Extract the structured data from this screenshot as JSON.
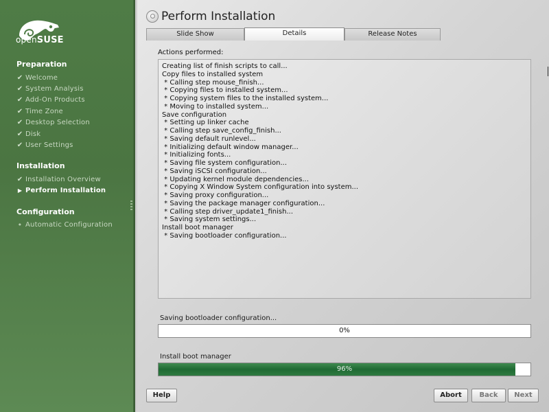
{
  "logo": {
    "prefix": "open",
    "brand": "SUSE"
  },
  "sidebar": {
    "sections": [
      {
        "label": "Preparation",
        "items": [
          {
            "label": "Welcome",
            "state": "done"
          },
          {
            "label": "System Analysis",
            "state": "done"
          },
          {
            "label": "Add-On Products",
            "state": "done"
          },
          {
            "label": "Time Zone",
            "state": "done"
          },
          {
            "label": "Desktop Selection",
            "state": "done"
          },
          {
            "label": "Disk",
            "state": "done"
          },
          {
            "label": "User Settings",
            "state": "done"
          }
        ]
      },
      {
        "label": "Installation",
        "items": [
          {
            "label": "Installation Overview",
            "state": "done"
          },
          {
            "label": "Perform Installation",
            "state": "active"
          }
        ]
      },
      {
        "label": "Configuration",
        "items": [
          {
            "label": "Automatic Configuration",
            "state": "pending"
          }
        ]
      }
    ]
  },
  "main": {
    "title": "Perform Installation",
    "tabs": [
      {
        "label": "Slide Show"
      },
      {
        "label": "Details"
      },
      {
        "label": "Release Notes"
      }
    ],
    "actions_label": "Actions performed:",
    "log": [
      "Creating list of finish scripts to call...",
      "Copy files to installed system",
      " * Calling step mouse_finish...",
      " * Copying files to installed system...",
      " * Copying system files to the installed system...",
      " * Moving to installed system...",
      "Save configuration",
      " * Setting up linker cache",
      " * Calling step save_config_finish...",
      " * Saving default runlevel...",
      " * Initializing default window manager...",
      " * Initializing fonts...",
      " * Saving file system configuration...",
      " * Saving iSCSI configuration...",
      " * Updating kernel module dependencies...",
      " * Copying X Window System configuration into system...",
      " * Saving proxy configuration...",
      " * Saving the package manager configuration...",
      " * Calling step driver_update1_finish...",
      " * Saving system settings...",
      "Install boot manager",
      " * Saving bootloader configuration..."
    ],
    "progress1": {
      "label": "Saving bootloader configuration...",
      "value_text": "0%",
      "fraction": 0.0
    },
    "progress2": {
      "label": "Install boot manager",
      "value_text": "96%",
      "fraction": 0.96
    }
  },
  "buttons": {
    "help": "Help",
    "abort": "Abort",
    "back": "Back",
    "next": "Next"
  },
  "colors": {
    "sidebar_green": "#4f7c46",
    "progress_green": "#1f6a33"
  }
}
